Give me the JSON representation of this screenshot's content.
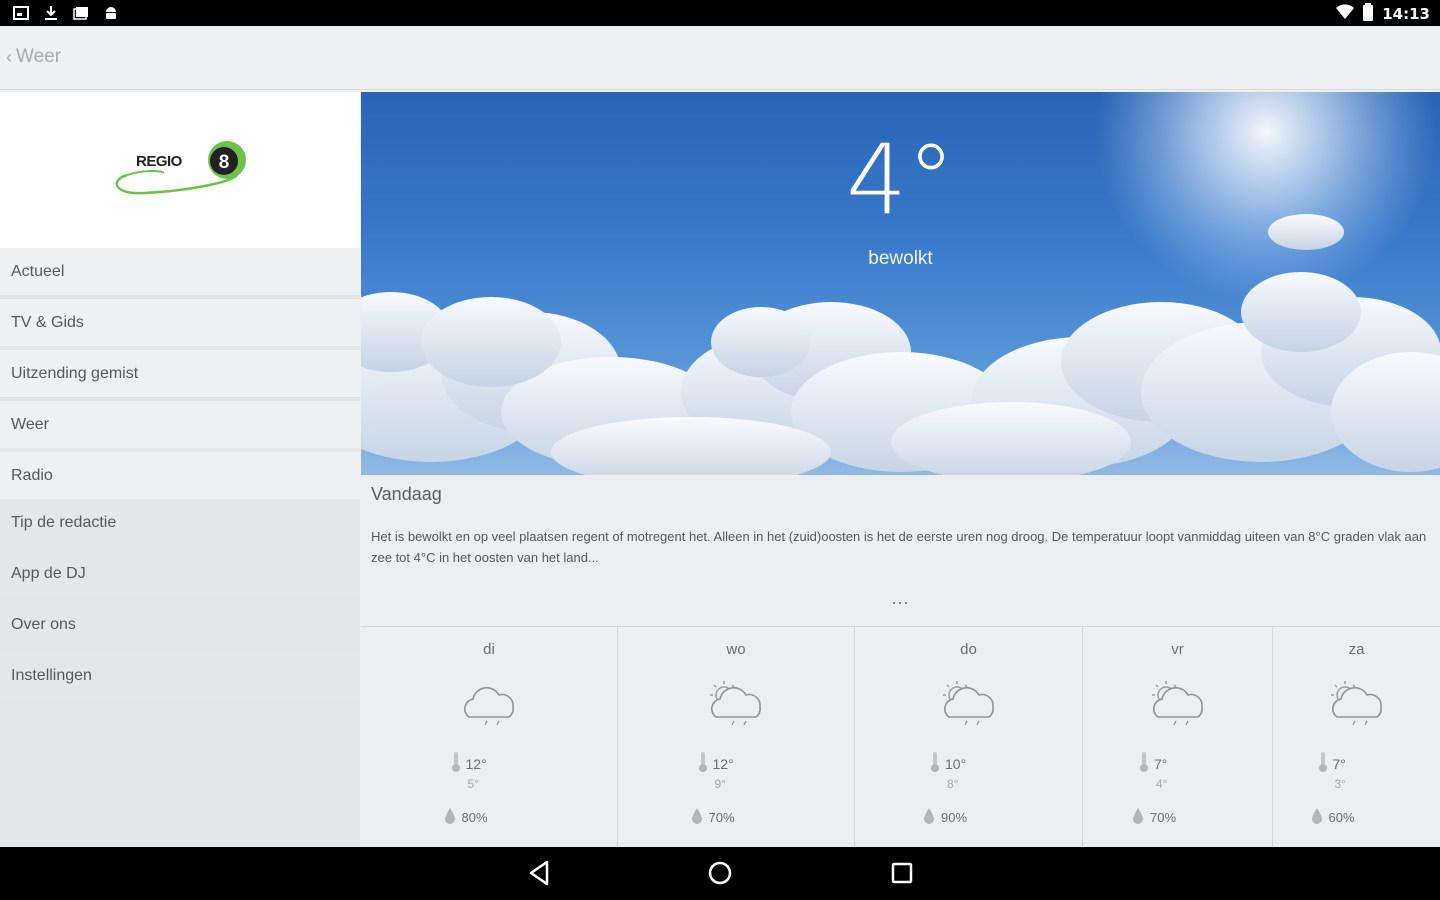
{
  "status_bar": {
    "time": "14:13",
    "left_icons": [
      "screenshot-icon",
      "download-icon",
      "photos-icon",
      "android-icon"
    ],
    "right_icons": [
      "wifi-icon",
      "battery-icon"
    ]
  },
  "app_bar": {
    "back_label": "Weer"
  },
  "sidebar": {
    "logo_text": "REGIO",
    "logo_number": "8",
    "items": [
      {
        "label": "Actueel"
      },
      {
        "label": "TV & Gids"
      },
      {
        "label": "Uitzending gemist"
      },
      {
        "label": "Weer"
      },
      {
        "label": "Radio"
      }
    ],
    "secondary_items": [
      {
        "label": "Tip de redactie"
      },
      {
        "label": "App de DJ"
      },
      {
        "label": "Over ons"
      },
      {
        "label": "Instellingen"
      }
    ]
  },
  "current": {
    "temperature": "4°",
    "condition": "bewolkt"
  },
  "today": {
    "title": "Vandaag",
    "text": "Het is bewolkt en op veel plaatsen regent of motregent het. Alleen in het (zuid)oosten is het de eerste uren nog droog. De temperatuur loopt vanmiddag uiteen van 8°C graden vlak aan zee tot 4°C in het oosten van het land...",
    "more": "..."
  },
  "forecast": [
    {
      "day": "di",
      "icon": "cloud-rain-icon",
      "high": "12°",
      "low": "5°",
      "rain": "80%"
    },
    {
      "day": "wo",
      "icon": "sun-cloud-rain-icon",
      "high": "12°",
      "low": "9°",
      "rain": "70%"
    },
    {
      "day": "do",
      "icon": "sun-cloud-rain-icon",
      "high": "10°",
      "low": "8°",
      "rain": "90%"
    },
    {
      "day": "vr",
      "icon": "sun-cloud-rain-icon",
      "high": "7°",
      "low": "4°",
      "rain": "70%"
    },
    {
      "day": "za",
      "icon": "sun-cloud-rain-icon",
      "high": "7°",
      "low": "3°",
      "rain": "60%"
    }
  ],
  "colors": {
    "sky_top": "#2a64b4",
    "logo_green": "#6cc24a"
  },
  "system_nav": [
    "back-icon",
    "home-icon",
    "recents-icon"
  ]
}
